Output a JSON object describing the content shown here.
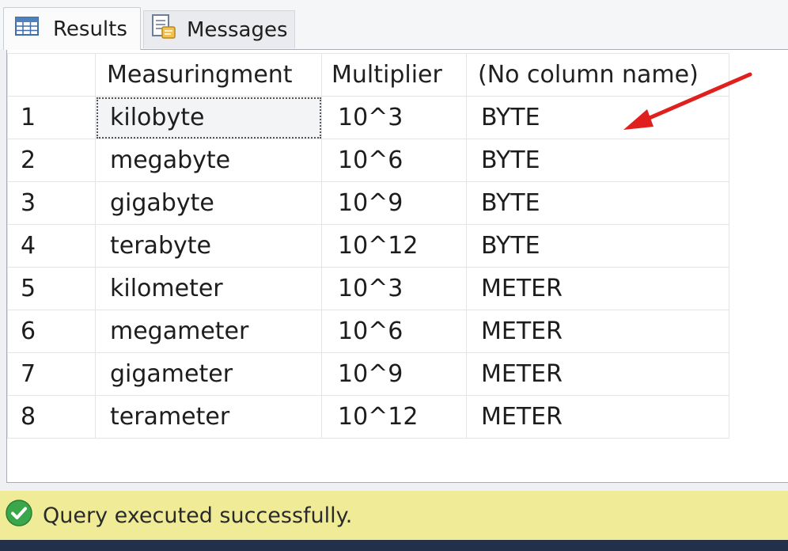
{
  "tabs": {
    "results": {
      "label": "Results",
      "icon": "grid-icon"
    },
    "messages": {
      "label": "Messages",
      "icon": "messages-icon"
    }
  },
  "grid": {
    "columns": [
      "",
      "Measuringment",
      "Multiplier",
      "(No column name)"
    ],
    "rows": [
      {
        "num": "1",
        "measuringment": "kilobyte",
        "multiplier": "10^3",
        "unit": "BYTE"
      },
      {
        "num": "2",
        "measuringment": "megabyte",
        "multiplier": "10^6",
        "unit": "BYTE"
      },
      {
        "num": "3",
        "measuringment": "gigabyte",
        "multiplier": "10^9",
        "unit": "BYTE"
      },
      {
        "num": "4",
        "measuringment": "terabyte",
        "multiplier": "10^12",
        "unit": "BYTE"
      },
      {
        "num": "5",
        "measuringment": "kilometer",
        "multiplier": "10^3",
        "unit": "METER"
      },
      {
        "num": "6",
        "measuringment": "megameter",
        "multiplier": "10^6",
        "unit": "METER"
      },
      {
        "num": "7",
        "measuringment": "gigameter",
        "multiplier": "10^9",
        "unit": "METER"
      },
      {
        "num": "8",
        "measuringment": "terameter",
        "multiplier": "10^12",
        "unit": "METER"
      }
    ],
    "selected_cell": "kilobyte"
  },
  "status": {
    "text": "Query executed successfully.",
    "icon": "check-circle-icon"
  },
  "colors": {
    "status_bg": "#f0eb97",
    "annotation_arrow": "#e0201c",
    "success_green": "#3aa84a"
  }
}
